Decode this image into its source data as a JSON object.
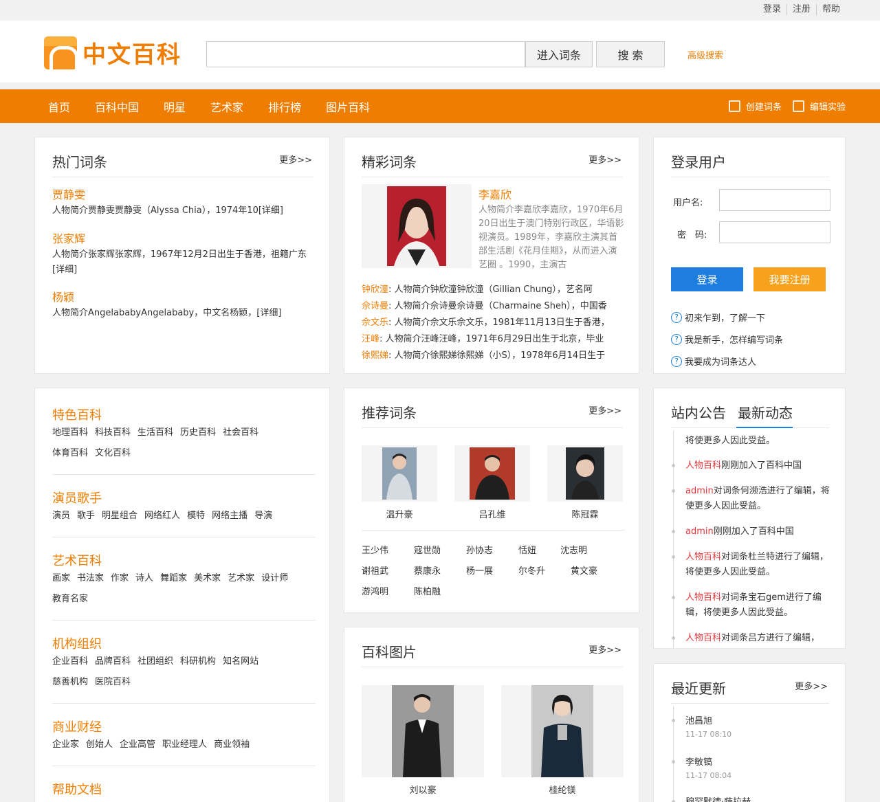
{
  "toplinks": [
    "登录",
    "注册",
    "帮助"
  ],
  "logo_text": "中文百科",
  "search": {
    "placeholder": "",
    "enter_btn": "进入词条",
    "search_btn": "搜 索",
    "advanced": "高级搜索"
  },
  "nav": {
    "items": [
      "首页",
      "百科中国",
      "明星",
      "艺术家",
      "排行榜",
      "图片百科"
    ],
    "create": "创建词条",
    "edit": "编辑实验"
  },
  "hot": {
    "title": "热门词条",
    "more": "更多>>",
    "items": [
      {
        "name": "贾静雯",
        "desc": "人物简介贾静雯贾静雯（Alyssa Chia），1974年10[详细]"
      },
      {
        "name": "张家辉",
        "desc": "人物简介张家辉张家辉，1967年12月2日出生于香港，祖籍广东[详细]"
      },
      {
        "name": "杨颖",
        "desc": "人物简介AngelababyAngelababy，中文名杨颖，[详细]"
      }
    ]
  },
  "featured": {
    "title": "精彩词条",
    "more": "更多>>",
    "main": {
      "name": "李嘉欣",
      "desc": "人物简介李嘉欣李嘉欣，1970年6月20日出生于澳门特别行政区，华语影视演员。1989年，李嘉欣主演其首部生活剧《花月佳期》，从而进入演艺圈 。1990，主演古"
    },
    "list": [
      {
        "name": "钟欣潼",
        "desc": ": 人物简介钟欣潼钟欣潼（Gillian Chung），艺名阿"
      },
      {
        "name": "佘诗曼",
        "desc": ": 人物简介佘诗曼佘诗曼（Charmaine Sheh），中国香"
      },
      {
        "name": "佘文乐",
        "desc": ": 人物简介佘文乐佘文乐，1981年11月13日生于香港，"
      },
      {
        "name": "汪峰",
        "desc": ": 人物简介汪峰汪峰，1971年6月29日出生于北京，毕业"
      },
      {
        "name": "徐熙娣",
        "desc": ": 人物简介徐熙娣徐熙娣（小S），1978年6月14日生于"
      }
    ]
  },
  "login": {
    "title": "登录用户",
    "username_label": "用户名:",
    "password_label": "密　码:",
    "login_btn": "登录",
    "register_btn": "我要注册",
    "help": [
      "初来乍到，了解一下",
      "我是新手，怎样编写词条",
      "我要成为词条达人"
    ]
  },
  "categories": [
    {
      "title": "特色百科",
      "tags": [
        "地理百科",
        "科技百科",
        "生活百科",
        "历史百科",
        "社会百科",
        "体育百科",
        "文化百科"
      ]
    },
    {
      "title": "演员歌手",
      "tags": [
        "演员",
        "歌手",
        "明星组合",
        "网络红人",
        "模特",
        "网络主播",
        "导演"
      ]
    },
    {
      "title": "艺术百科",
      "tags": [
        "画家",
        "书法家",
        "作家",
        "诗人",
        "舞蹈家",
        "美术家",
        "艺术家",
        "设计师",
        "教育名家"
      ]
    },
    {
      "title": "机构组织",
      "tags": [
        "企业百科",
        "品牌百科",
        "社团组织",
        "科研机构",
        "知名网站",
        "慈善机构",
        "医院百科"
      ]
    },
    {
      "title": "商业财经",
      "tags": [
        "企业家",
        "创始人",
        "企业高管",
        "职业经理人",
        "商业领袖"
      ]
    },
    {
      "title": "帮助文档",
      "tags": []
    }
  ],
  "recommend": {
    "title": "推荐词条",
    "more": "更多>>",
    "photos": [
      "温升豪",
      "吕孔维",
      "陈冠霖"
    ],
    "names": [
      "王少伟",
      "寇世勋",
      "孙协志",
      "恬妞",
      "沈志明",
      "谢祖武",
      "蔡康永",
      "杨一展",
      "尔冬升",
      "黄文豪",
      "游鸿明",
      "陈柏融"
    ]
  },
  "pics": {
    "title": "百科图片",
    "more": "更多>>",
    "items": [
      "刘以豪",
      "桂纶镁"
    ]
  },
  "notice": {
    "tab1": "站内公告",
    "tab2": "最新动态",
    "items": [
      {
        "who": "",
        "text": "将使更多人因此受益。"
      },
      {
        "who": "人物百科",
        "text": "刚刚加入了百科中国"
      },
      {
        "who": "admin",
        "text": "对词条何濒浩进行了编辑，将使更多人因此受益。"
      },
      {
        "who": "admin",
        "text": "刚刚加入了百科中国"
      },
      {
        "who": "人物百科",
        "text": "对词条杜兰特进行了编辑，将使更多人因此受益。"
      },
      {
        "who": "人物百科",
        "text": "对词条宝石gem进行了编辑，将使更多人因此受益。"
      },
      {
        "who": "人物百科",
        "text": "对词条吕方进行了编辑，"
      }
    ]
  },
  "recent": {
    "title": "最近更新",
    "more": "更多>>",
    "items": [
      {
        "name": "池昌旭",
        "time": "11-17 08:10"
      },
      {
        "name": "李敏镐",
        "time": "11-17 08:04"
      },
      {
        "name": "穆罕默德·萨拉赫",
        "time": ""
      }
    ]
  },
  "colors": {
    "accent": "#ef7d00",
    "login_btn": "#1e7ee0",
    "register_btn": "#f7a21c",
    "highlight": "#e4393c"
  }
}
